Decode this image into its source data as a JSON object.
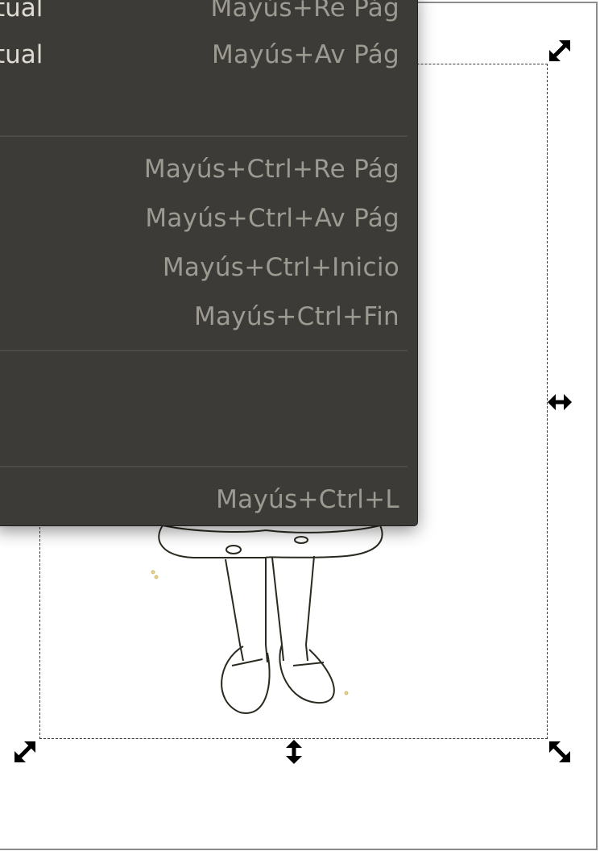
{
  "menu": {
    "items": [
      {
        "label": "tual",
        "accelerator": "Mayús+Re Pág"
      },
      {
        "label": "tual",
        "accelerator": "Mayús+Av Pág"
      },
      {
        "label": "",
        "accelerator": ""
      },
      {
        "label": "",
        "accelerator": "Mayús+Ctrl+Re Pág"
      },
      {
        "label": "",
        "accelerator": "Mayús+Ctrl+Av Pág"
      },
      {
        "label": "",
        "accelerator": "Mayús+Ctrl+Inicio"
      },
      {
        "label": "",
        "accelerator": "Mayús+Ctrl+Fin"
      },
      {
        "label": "",
        "accelerator": ""
      },
      {
        "label": "",
        "accelerator": ""
      },
      {
        "label": "",
        "accelerator": "Mayús+Ctrl+L"
      }
    ]
  },
  "colors": {
    "menu_background": "#3c3b37",
    "menu_text": "#dfdbd2",
    "menu_accelerator": "#9d9a92",
    "canvas": "#ffffff"
  },
  "icons": {
    "handles": [
      "resize-diagonal-icon",
      "resize-horizontal-icon",
      "resize-vertical-icon"
    ]
  }
}
